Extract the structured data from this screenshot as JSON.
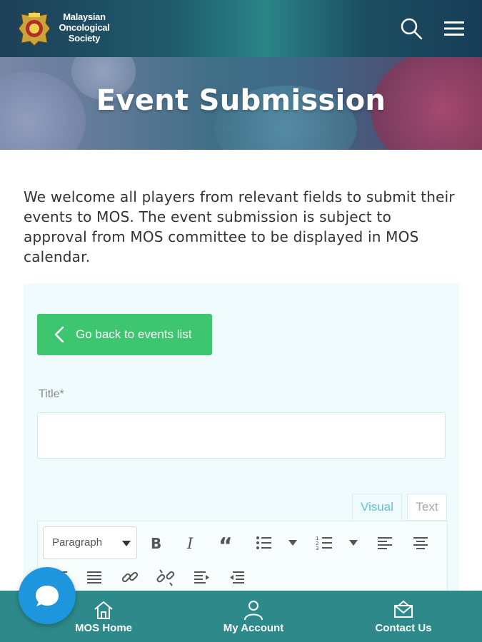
{
  "header": {
    "brand_lines": [
      "Malaysian",
      "Oncological",
      "Society"
    ],
    "search_icon": "search-icon",
    "menu_icon": "hamburger-menu-icon"
  },
  "hero": {
    "title": "Event Submission"
  },
  "intro": {
    "text": "We welcome all players from relevant fields to submit their events to MOS. The event submission is subject to approval from MOS committee to be displayed in MOS calendar."
  },
  "form": {
    "back_button_label": "Go back to events list",
    "title_label": "Title*",
    "title_value": "",
    "editor": {
      "tabs": [
        {
          "label": "Visual",
          "active": true
        },
        {
          "label": "Text",
          "active": false
        }
      ],
      "format_select": "Paragraph",
      "toolbar_icons": [
        "bold-icon",
        "italic-icon",
        "blockquote-icon",
        "bullet-list-icon",
        "chevron-down-icon",
        "numbered-list-icon",
        "chevron-down-icon",
        "align-left-icon",
        "align-center-icon",
        "align-right-icon",
        "justify-icon",
        "link-icon",
        "unlink-icon",
        "indent-icon",
        "outdent-icon"
      ]
    }
  },
  "bottom_nav": {
    "items": [
      {
        "label": "MOS Home",
        "icon": "home-icon"
      },
      {
        "label": "My Account",
        "icon": "user-icon"
      },
      {
        "label": "Contact Us",
        "icon": "mail-icon"
      }
    ]
  },
  "chat": {
    "icon": "chat-icon"
  },
  "colors": {
    "header": "#1f5a6a",
    "accent_green": "#3ec56f",
    "bottom_nav": "#2e8a8a",
    "chat": "#1d96dd",
    "tab_active": "#5ec3d6"
  }
}
